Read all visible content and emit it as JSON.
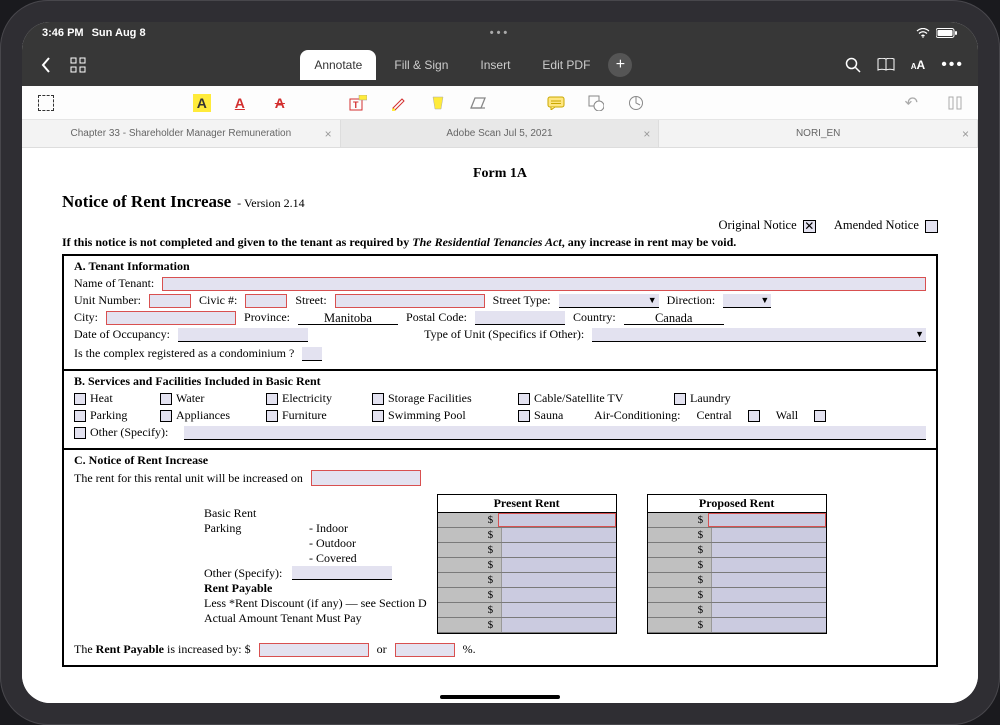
{
  "status": {
    "time": "3:46 PM",
    "date": "Sun Aug 8"
  },
  "modes": {
    "annotate": "Annotate",
    "fillsign": "Fill & Sign",
    "insert": "Insert",
    "editpdf": "Edit PDF"
  },
  "docs": {
    "tab1": "Chapter 33 - Shareholder Manager Remuneration",
    "tab2": "Adobe Scan Jul 5, 2021",
    "tab3": "NORI_EN"
  },
  "form": {
    "header": "Form 1A",
    "title": "Notice of Rent Increase",
    "version": "- Version 2.14",
    "original": "Original Notice",
    "amended": "Amended Notice",
    "req_pre": "If this notice is not completed and given to the tenant as required by ",
    "req_em": "The Residential Tenancies Act",
    "req_post": ", any increase in rent may be void.",
    "a": {
      "heading": "A.  Tenant Information",
      "name": "Name of Tenant:",
      "unit": "Unit Number:",
      "civic": "Civic #:",
      "street": "Street:",
      "streettype": "Street Type:",
      "direction": "Direction:",
      "city": "City:",
      "province": "Province:",
      "province_v": "Manitoba",
      "postal": "Postal Code:",
      "country": "Country:",
      "country_v": "Canada",
      "occ": "Date of Occupancy:",
      "typeunit": "Type of Unit (Specifics if Other):",
      "condo": "Is the complex registered as a condominium ?"
    },
    "b": {
      "heading": "B.  Services and Facilities Included in Basic Rent",
      "heat": "Heat",
      "water": "Water",
      "elec": "Electricity",
      "storage": "Storage Facilities",
      "cable": "Cable/Satellite TV",
      "laundry": "Laundry",
      "parking": "Parking",
      "appl": "Appliances",
      "furn": "Furniture",
      "pool": "Swimming Pool",
      "sauna": "Sauna",
      "ac": "Air-Conditioning:",
      "central": "Central",
      "wall": "Wall",
      "other": "Other  (Specify):"
    },
    "c": {
      "heading": "C.  Notice of Rent Increase",
      "intro": "The rent for this rental unit will be increased on",
      "present": "Present Rent",
      "proposed": "Proposed Rent",
      "basic": "Basic Rent",
      "parking": "Parking",
      "indoor": "-  Indoor",
      "outdoor": "-  Outdoor",
      "covered": "-  Covered",
      "otherspec": "Other (Specify):",
      "payable": "Rent Payable",
      "less": " Less *Rent Discount (if any) — see Section D",
      "actual": "Actual Amount Tenant Must Pay",
      "dollar": "$",
      "inc_pre": "The ",
      "inc_b": "Rent Payable",
      "inc_mid": " is increased by:   $",
      "or": "or",
      "pct": "%."
    }
  }
}
